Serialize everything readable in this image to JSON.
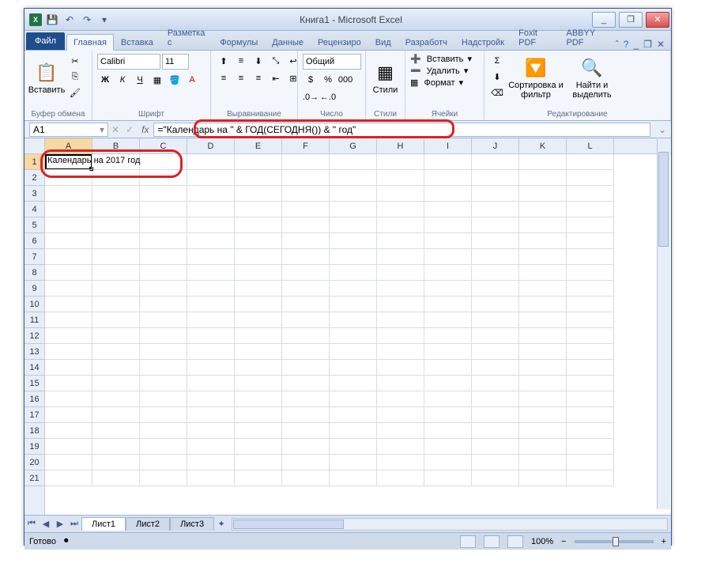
{
  "window": {
    "title": "Книга1 - Microsoft Excel",
    "min": "_",
    "max": "❐",
    "close": "✕"
  },
  "tabs": {
    "file": "Файл",
    "items": [
      "Главная",
      "Вставка",
      "Разметка с",
      "Формулы",
      "Данные",
      "Рецензиро",
      "Вид",
      "Разработч",
      "Надстройк",
      "Foxit PDF",
      "ABBYY PDF"
    ],
    "active": 0
  },
  "ribbon": {
    "clipboard": {
      "paste": "Вставить",
      "label": "Буфер обмена",
      "cut": "✂",
      "copy": "⎘",
      "brush": "🖌"
    },
    "font": {
      "label": "Шрифт",
      "name": "Calibri",
      "size": "11",
      "bold": "Ж",
      "italic": "К",
      "underline": "Ч"
    },
    "align": {
      "label": "Выравнивание",
      "wrap": "≡"
    },
    "number": {
      "label": "Число",
      "format": "Общий"
    },
    "styles": {
      "label": "Стили",
      "btn": "Стили"
    },
    "cells": {
      "label": "Ячейки",
      "insert": "Вставить",
      "delete": "Удалить",
      "format": "Формат"
    },
    "edit": {
      "label": "Редактирование",
      "sum": "Σ",
      "sort": "Сортировка и фильтр",
      "find": "Найти и выделить"
    }
  },
  "namebox": "A1",
  "formula": "=\"Календарь на \" & ГОД(СЕГОДНЯ()) & \" год\"",
  "columns": [
    "A",
    "B",
    "C",
    "D",
    "E",
    "F",
    "G",
    "H",
    "I",
    "J",
    "K",
    "L"
  ],
  "rows_count": 21,
  "cell_a1": "Календарь на 2017 год",
  "sheets": {
    "nav": [
      "⏮",
      "◀",
      "▶",
      "⏭"
    ],
    "tabs": [
      "Лист1",
      "Лист2",
      "Лист3"
    ],
    "active": 0
  },
  "status": {
    "ready": "Готово",
    "zoom": "100%",
    "minus": "−",
    "plus": "+"
  }
}
